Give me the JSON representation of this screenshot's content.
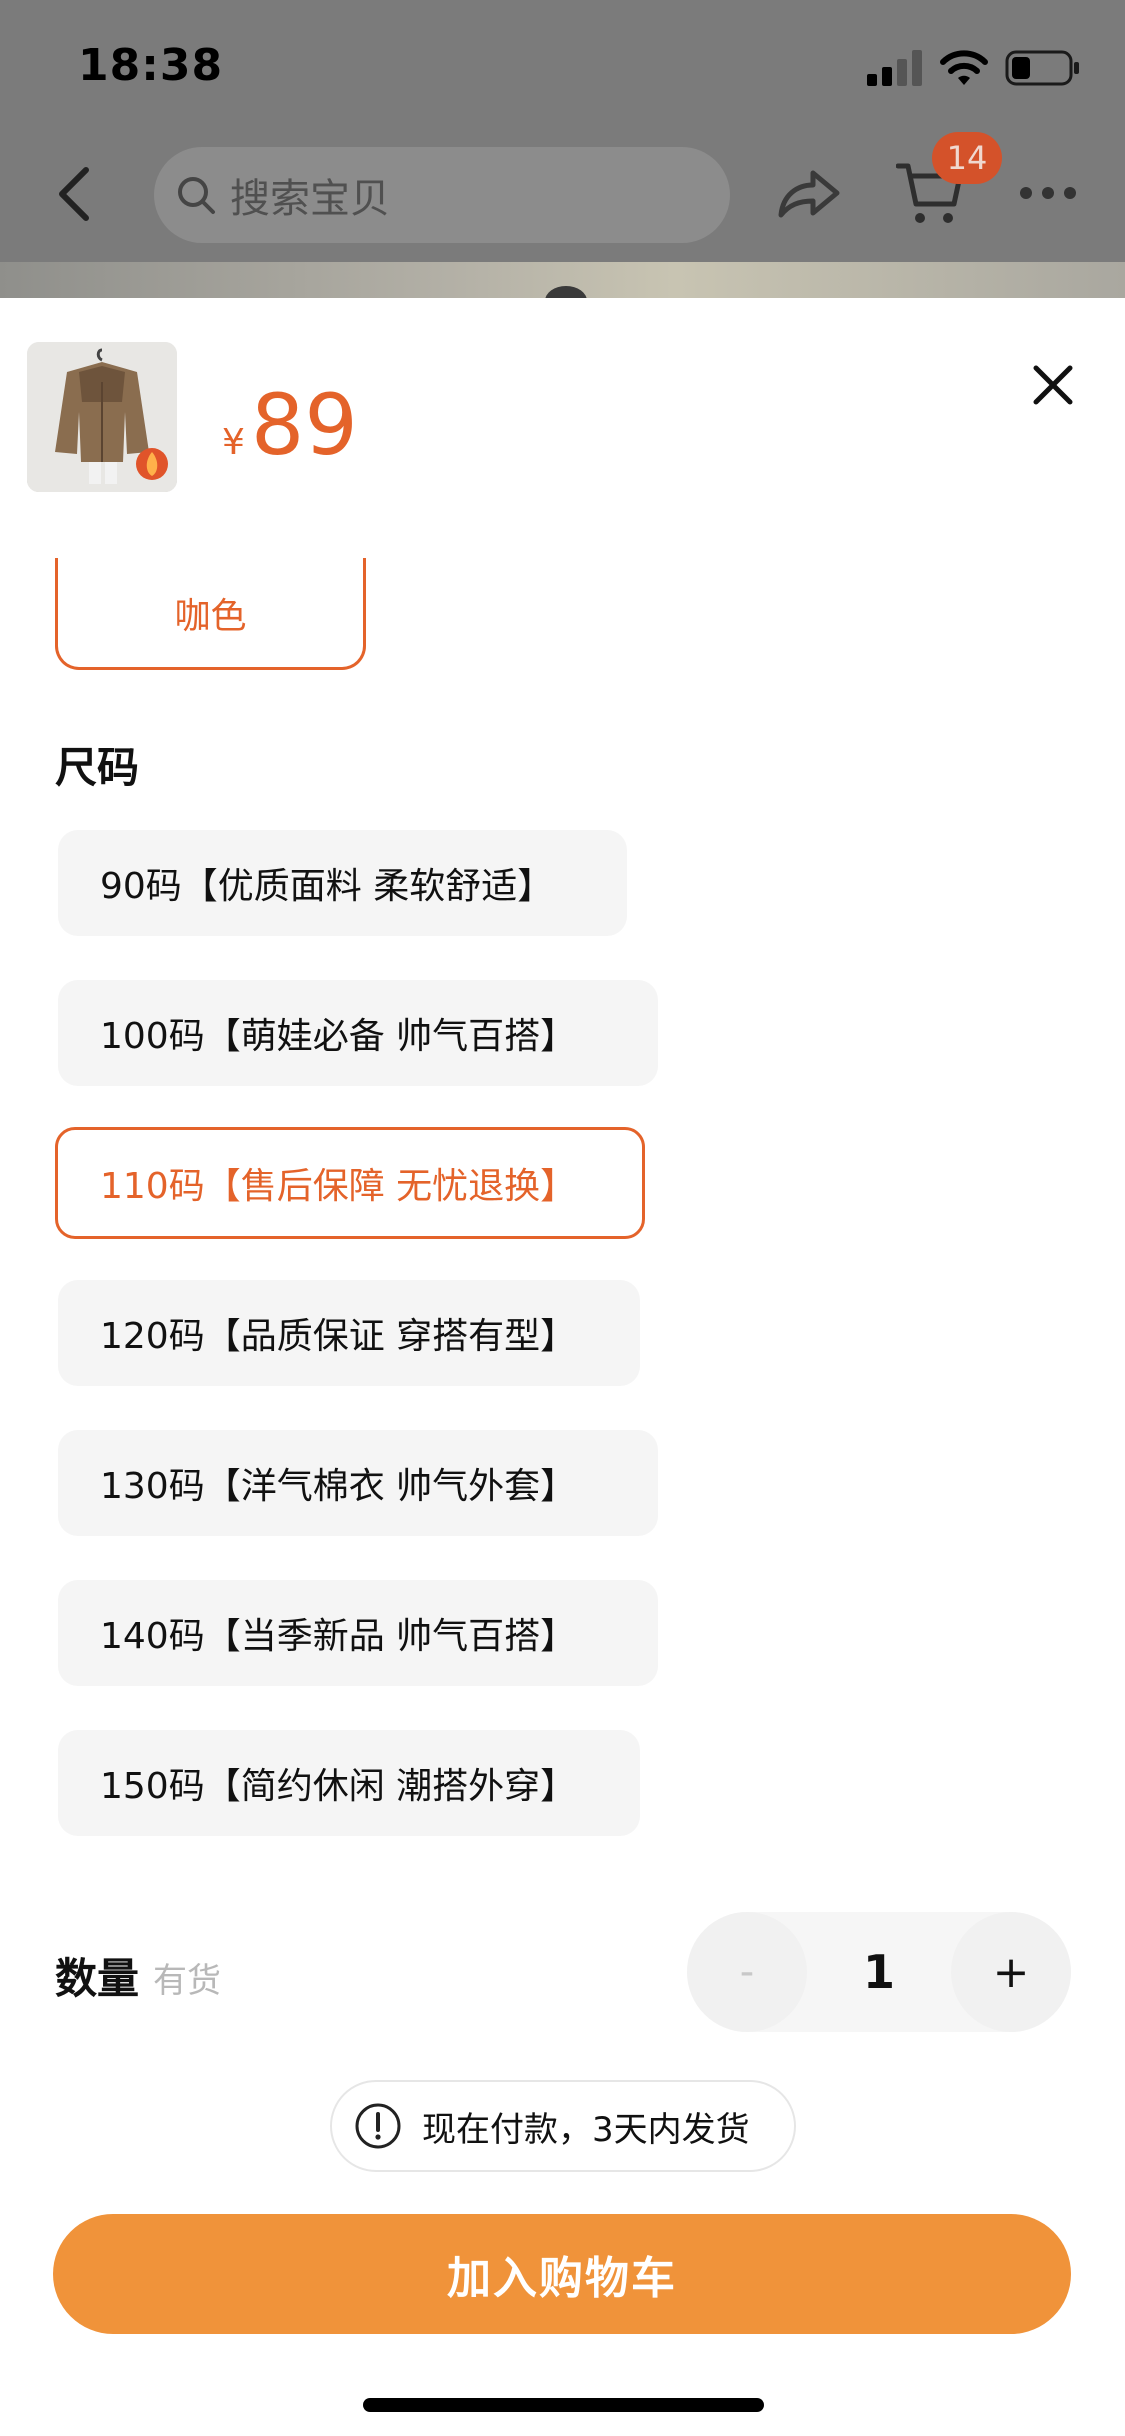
{
  "status_bar": {
    "time": "18:38"
  },
  "nav": {
    "search_placeholder": "搜索宝贝",
    "cart_count": "14"
  },
  "product": {
    "currency": "¥",
    "price": "89",
    "thumbnail_icon": "jacket-photo"
  },
  "color": {
    "selected_label": "咖色"
  },
  "size": {
    "title": "尺码",
    "options": [
      {
        "label": "90码【优质面料 柔软舒适】"
      },
      {
        "label": "100码【萌娃必备 帅气百搭】"
      },
      {
        "label": "110码【售后保障 无忧退换】"
      },
      {
        "label": "120码【品质保证 穿搭有型】"
      },
      {
        "label": "130码【洋气棉衣 帅气外套】"
      },
      {
        "label": "140码【当季新品 帅气百搭】"
      },
      {
        "label": "150码【简约休闲 潮搭外穿】"
      }
    ],
    "selected_index": 2
  },
  "quantity": {
    "label": "数量",
    "stock": "有货",
    "minus": "-",
    "value": "1",
    "plus": "+"
  },
  "shipping_notice": "现在付款，3天内发货",
  "actions": {
    "add_to_cart": "加入购物车"
  },
  "colors": {
    "accent": "#e4632a",
    "button": "#f0933a",
    "option_bg": "#f5f5f5"
  }
}
